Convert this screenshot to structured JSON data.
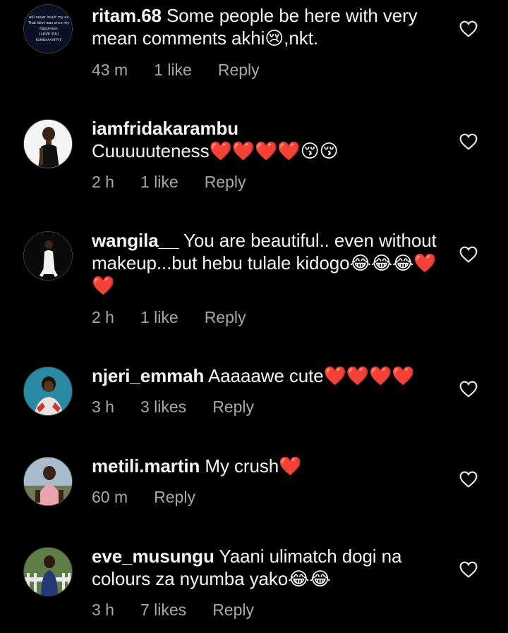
{
  "comments": [
    {
      "username": "ritam.68",
      "text": "Some people be here with very mean comments akhi😢,nkt.",
      "time": "43 m",
      "likes": "1 like",
      "reply": "Reply",
      "avatar_text": [
        "will never insult my ex",
        "That idiot was once my",
        "happiness",
        "I LOVE YOU",
        "KUMBAAAAFFFF"
      ]
    },
    {
      "username": "iamfridakarambu",
      "text": "Cuuuuuteness❤️❤️❤️❤️😚😚",
      "time": "2 h",
      "likes": "1 like",
      "reply": "Reply"
    },
    {
      "username": "wangila__",
      "text": "You are beautiful.. even without makeup...but hebu tulale kidogo😂😂😂❤️❤️",
      "time": "2 h",
      "likes": "1 like",
      "reply": "Reply"
    },
    {
      "username": "njeri_emmah",
      "text": "Aaaaawe cute❤️❤️❤️❤️",
      "time": "3 h",
      "likes": "3 likes",
      "reply": "Reply"
    },
    {
      "username": "metili.martin",
      "text": "My crush❤️",
      "time": "60 m",
      "likes": "",
      "reply": "Reply"
    },
    {
      "username": "eve_musungu",
      "text": "Yaani ulimatch dogi na colours za nyumba yako😂😂",
      "time": "3 h",
      "likes": "7 likes",
      "reply": "Reply"
    }
  ],
  "icons": {
    "like": "heart-outline-icon"
  },
  "colors": {
    "background": "#000000",
    "text": "#f5f5f5",
    "meta": "#a8a8a8"
  }
}
